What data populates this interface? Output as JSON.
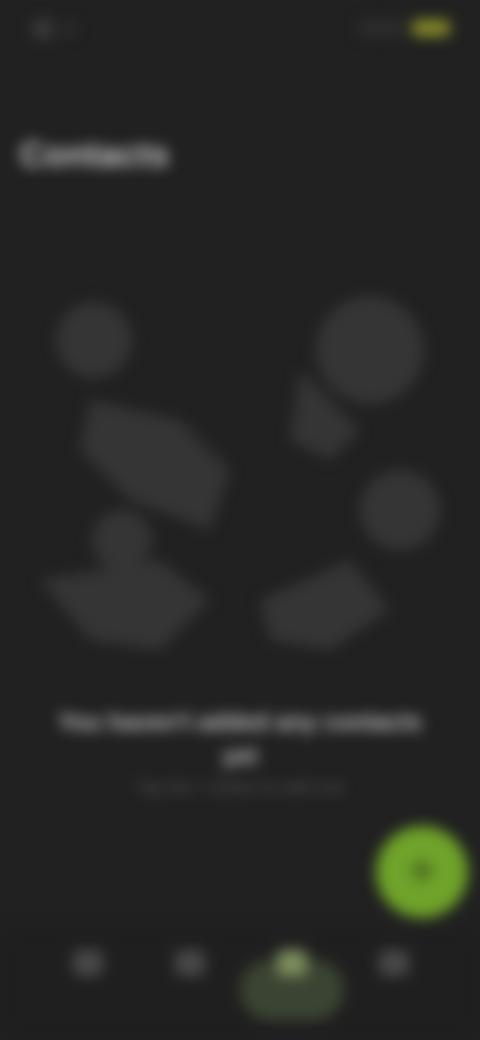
{
  "colors": {
    "background": "#212121",
    "accent": "#6fa32a",
    "active_nav_pill": "#3b4432",
    "title_text": "#d0d0d0"
  },
  "status_bar": {
    "icons": [
      "app-notification-icon",
      "notification-icon",
      "signal-icon",
      "battery-icon"
    ]
  },
  "header": {
    "title": "Contacts"
  },
  "empty_state": {
    "illustration_icon": "empty-contacts-illustration",
    "title": "You haven't added any contacts yet",
    "subtitle": "Tap the + button to add one"
  },
  "fab": {
    "icon": "plus-icon",
    "label": "+"
  },
  "bottom_nav": {
    "items": [
      {
        "icon": "home-icon",
        "label": "",
        "active": false
      },
      {
        "icon": "people-icon",
        "label": "",
        "active": false
      },
      {
        "icon": "contacts-icon",
        "label": "",
        "active": true
      },
      {
        "icon": "settings-icon",
        "label": "",
        "active": false
      }
    ]
  }
}
